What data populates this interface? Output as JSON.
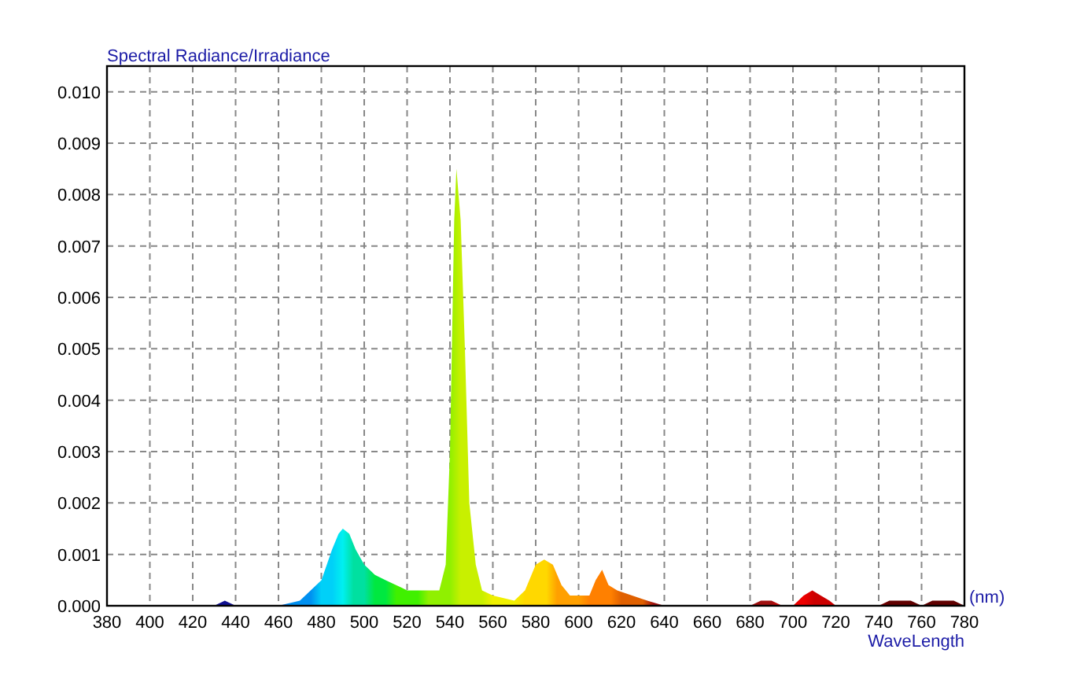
{
  "chart": {
    "unit_label": "(nm)",
    "chart_data": {
      "type": "area",
      "title": "Spectral Radiance/Irradiance",
      "xlabel": "WaveLength",
      "x": [
        380,
        430,
        435,
        440,
        455,
        460,
        470,
        480,
        485,
        488,
        490,
        493,
        496,
        500,
        505,
        510,
        520,
        530,
        535,
        538,
        540,
        542,
        543,
        545,
        547,
        549,
        552,
        555,
        560,
        570,
        575,
        580,
        584,
        588,
        592,
        596,
        600,
        605,
        608,
        611,
        614,
        618,
        625,
        632,
        640,
        680,
        685,
        690,
        695,
        700,
        705,
        709,
        713,
        717,
        720,
        740,
        745,
        755,
        760,
        765,
        775,
        780
      ],
      "values": [
        0,
        0,
        0.0001,
        0,
        0,
        0,
        0.0001,
        0.0005,
        0.0011,
        0.0014,
        0.0015,
        0.0014,
        0.0011,
        0.0008,
        0.0006,
        0.0005,
        0.0003,
        0.0003,
        0.0003,
        0.0008,
        0.003,
        0.0075,
        0.0085,
        0.0075,
        0.005,
        0.002,
        0.0008,
        0.0003,
        0.0002,
        0.0001,
        0.0003,
        0.0008,
        0.0009,
        0.0008,
        0.0004,
        0.0002,
        0.0002,
        0.0002,
        0.0005,
        0.0007,
        0.0004,
        0.0003,
        0.0002,
        0.0001,
        0,
        0,
        0.0001,
        0.0001,
        0,
        0,
        0.0002,
        0.0003,
        0.0002,
        0.0001,
        0,
        0,
        0.0001,
        0.0001,
        0,
        0.0001,
        0.0001,
        0
      ],
      "grid": true,
      "xlim": [
        380,
        780
      ],
      "ylim": [
        0,
        0.0105
      ],
      "xticks": [
        380,
        400,
        420,
        440,
        460,
        480,
        500,
        520,
        540,
        560,
        580,
        600,
        620,
        640,
        660,
        680,
        700,
        720,
        740,
        760,
        780
      ],
      "yticks": [
        {
          "value": 0,
          "label": "0.000"
        },
        {
          "value": 0.001,
          "label": "0.001"
        },
        {
          "value": 0.002,
          "label": "0.002"
        },
        {
          "value": 0.003,
          "label": "0.003"
        },
        {
          "value": 0.004,
          "label": "0.004"
        },
        {
          "value": 0.005,
          "label": "0.005"
        },
        {
          "value": 0.006,
          "label": "0.006"
        },
        {
          "value": 0.007,
          "label": "0.007"
        },
        {
          "value": 0.008,
          "label": "0.008"
        },
        {
          "value": 0.009,
          "label": "0.009"
        },
        {
          "value": 0.01,
          "label": "0.010"
        }
      ]
    }
  }
}
